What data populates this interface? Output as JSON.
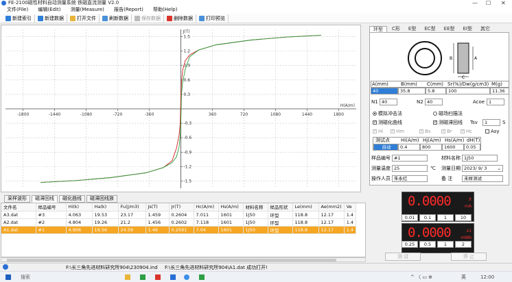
{
  "window": {
    "title": "FE-2100磁性材料自动测量系统 铁磁直流测量 V2.0",
    "minimize": "—",
    "maximize": "☐",
    "close": "✕"
  },
  "menu": [
    "文件(File)",
    "编辑(Edit)",
    "测量(Measure)",
    "报告(Report)",
    "帮助(Help)"
  ],
  "toolbar": [
    {
      "label": "新建索引",
      "icon": "new-index-icon",
      "color": "#2f7ed8",
      "enabled": true
    },
    {
      "label": "新建数据",
      "icon": "new-data-icon",
      "color": "#2f7ed8",
      "enabled": true
    },
    {
      "label": "打开文件",
      "icon": "open-folder-icon",
      "color": "#e8b53a",
      "enabled": true
    },
    {
      "label": "刷新数据",
      "icon": "refresh-icon",
      "color": "#4a90d9",
      "enabled": true
    },
    {
      "label": "保存数据",
      "icon": "save-icon",
      "color": "#bbbbbb",
      "enabled": false
    },
    {
      "label": "删除数据",
      "icon": "delete-icon",
      "color": "#d9342b",
      "enabled": true
    },
    {
      "label": "打印预览",
      "icon": "print-preview-icon",
      "color": "#4a90d9",
      "enabled": true
    }
  ],
  "chart_data": {
    "type": "line",
    "xlabel": "H(A/m)",
    "ylabel": "J(T)",
    "xlim": [
      -2000,
      2000
    ],
    "ylim": [
      -1.65,
      1.65
    ],
    "xticks": [
      -1800,
      -1440,
      -1080,
      -720,
      -360,
      360,
      720,
      1080,
      1440,
      1800
    ],
    "yticks": [
      -1.5,
      -1.2,
      -0.9,
      -0.6,
      -0.3,
      0.3,
      0.6,
      0.9,
      1.2,
      1.5
    ],
    "grid": true,
    "series": [
      {
        "color": "#d02020",
        "x": [
          -1600,
          -1200,
          -800,
          -400,
          -200,
          -100,
          -50,
          -20,
          -7,
          0,
          7,
          20,
          50,
          100,
          200,
          400,
          800,
          1200,
          1600
        ],
        "y": [
          -1.53,
          -1.49,
          -1.43,
          -1.33,
          -1.22,
          -1.08,
          -0.82,
          -0.55,
          -0.3,
          0.26,
          0.55,
          0.8,
          1.0,
          1.12,
          1.22,
          1.33,
          1.43,
          1.49,
          1.53
        ]
      },
      {
        "color": "#2a9a3a",
        "x": [
          -1600,
          -1200,
          -800,
          -400,
          -200,
          -100,
          -50,
          -20,
          -7,
          0,
          7,
          20,
          50,
          100,
          200,
          400,
          800,
          1200,
          1600
        ],
        "y": [
          -1.53,
          -1.49,
          -1.43,
          -1.33,
          -1.22,
          -1.12,
          -1.0,
          -0.8,
          -0.55,
          -0.26,
          0.3,
          0.55,
          0.82,
          1.08,
          1.22,
          1.33,
          1.43,
          1.49,
          1.53
        ]
      }
    ]
  },
  "bottom_tabs": [
    {
      "label": "采样波形",
      "active": false
    },
    {
      "label": "磁滞回线",
      "active": true
    },
    {
      "label": "磁化曲线",
      "active": false
    },
    {
      "label": "磁滞回线族",
      "active": false
    }
  ],
  "table": {
    "columns": [
      "文件名",
      "样品编号",
      "Hi(k)",
      "Ha(k)",
      "Fu(J/m3)",
      "Js(T)",
      "Jr(T)",
      "Hc(A/m)",
      "Hs(A/m)",
      "材料名称",
      "样品形状",
      "Le(mm)",
      "Ae(mm2)",
      "Ve"
    ],
    "rows": [
      {
        "cells": [
          "A3.dat",
          "#3",
          "4.063",
          "19.53",
          "23.17",
          "1.459",
          "0.2604",
          "7.011",
          "1601",
          "1J50",
          "环型",
          "118.8",
          "12.17",
          "1.4"
        ],
        "selected": false
      },
      {
        "cells": [
          "A2.dat",
          "#2",
          "4.804",
          "19.26",
          "21.2",
          "1.456",
          "0.2602",
          "7.118",
          "1601",
          "1J50",
          "环型",
          "118.8",
          "12.17",
          "1.4"
        ],
        "selected": false
      },
      {
        "cells": [
          "A1.dat",
          "#1",
          "4.906",
          "19.56",
          "24.59",
          "1.46",
          "0.2591",
          "7.04",
          "1601",
          "1J50",
          "环型",
          "118.8",
          "12.17",
          "1.4"
        ],
        "selected": true
      }
    ]
  },
  "status": {
    "path": "F:\\长三角先进材料研究所904\\230904.ind",
    "message": "F:\\长三角先进材料研究所904\\A1.dat 成功打开!"
  },
  "right_tabs": [
    {
      "label": "环型",
      "active": true
    },
    {
      "label": "C形",
      "active": false
    },
    {
      "label": "E型",
      "active": false
    },
    {
      "label": "EC型",
      "active": false
    },
    {
      "label": "EE型",
      "active": false
    },
    {
      "label": "EI型",
      "active": false
    },
    {
      "label": "其它",
      "active": false
    }
  ],
  "diagram": {
    "label_b": "B",
    "label_a": "A",
    "label_c": "C"
  },
  "sample_params": {
    "headers": [
      "A(mm)",
      "B(mm)",
      "C(mm)",
      "Sr(%)/Dw(g/cm3)",
      "M(g)"
    ],
    "values": [
      "40",
      "35.8",
      "5.8",
      "100",
      "11.36"
    ],
    "n1_label": "N1",
    "n1_value": "40",
    "n2_label": "N2",
    "n2_value": "40",
    "acoe_label": "Acoe",
    "acoe_value": "1"
  },
  "mode": {
    "impulse": "模拟冲击法",
    "scan": "磁场扫描法"
  },
  "options": {
    "magnetization_curve": "测磁化曲线",
    "hysteresis_loop": "测磁滞回线",
    "tsv_label": "Tsv",
    "tsv_value": "1",
    "tsv_unit": "S"
  },
  "grey_checks": [
    "Hi",
    "Hm",
    "Bs",
    "Br",
    "Hc",
    "Asy"
  ],
  "measure_points": {
    "headers": [
      "测试点",
      "Hi(A/m)",
      "Hj(A/m)",
      "Hs(A/m)",
      "dH(T)"
    ],
    "row": [
      "自动",
      "0.4",
      "800",
      "1600",
      "0.05"
    ]
  },
  "sample_info": {
    "sample_no_label": "样品编号",
    "sample_no": "#1",
    "material_label": "材料名称",
    "material": "1J50",
    "temp_label": "测量温度",
    "temp": "25",
    "temp_unit": "℃",
    "date_label": "测量日期",
    "date": "2023/ 9/ 3",
    "operator_label": "操作人员",
    "operator": "朱永红",
    "note_label": "备    注",
    "note": "未样测试"
  },
  "meter1": {
    "value": "0.0000",
    "unit_top": "/t",
    "unit_bottom": "mA",
    "scales": [
      "0.01",
      "0.1",
      "1",
      "10"
    ]
  },
  "meter2": {
    "value": "0.0000",
    "unit_top": "x1",
    "unit_bottom": "mWb",
    "scales": [
      "0.25",
      "0.5",
      "1",
      "2"
    ]
  },
  "buttons": {
    "test": "测  试",
    "stop": "停  止"
  },
  "taskbar": {
    "search": "搜索",
    "lang": "英",
    "time": "12:00",
    "tray": "^ 〈 ▭ ⊕"
  }
}
